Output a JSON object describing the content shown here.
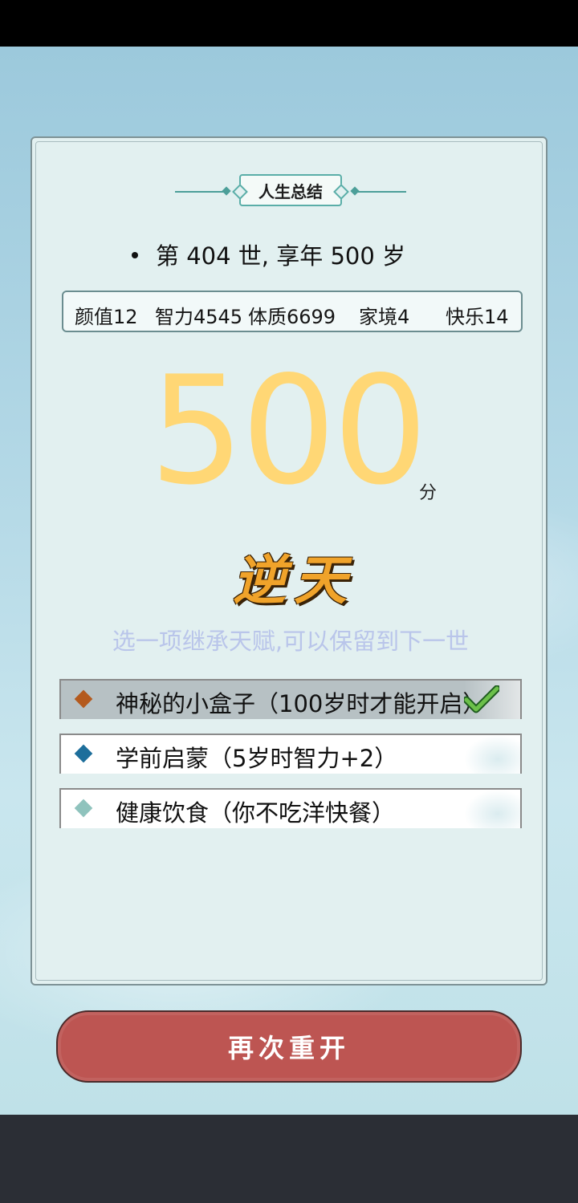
{
  "summary": {
    "title": "人生总结",
    "life_line": "第 404 世, 享年 500 岁"
  },
  "stats": {
    "beauty": "颜值12",
    "intelligence": "智力4545",
    "constitution": "体质6699",
    "family": "家境4",
    "happiness": "快乐14"
  },
  "score": {
    "value": "500",
    "unit": "分",
    "grade": "逆天",
    "score_color": "#ffd775"
  },
  "inherit_prompt": "选一项继承天赋,可以保留到下一世",
  "talents": [
    {
      "label": "神秘的小盒子（100岁时才能开启）",
      "gem_color": "#b45a1e",
      "selected": true
    },
    {
      "label": "学前启蒙（5岁时智力+2）",
      "gem_color": "#1d6e9b",
      "selected": false
    },
    {
      "label": "健康饮食（你不吃洋快餐）",
      "gem_color": "#8fc3bd",
      "selected": false
    }
  ],
  "restart_label": "再次重开",
  "colors": {
    "accent_teal": "#4c9f99",
    "button_red": "#bd5552"
  }
}
